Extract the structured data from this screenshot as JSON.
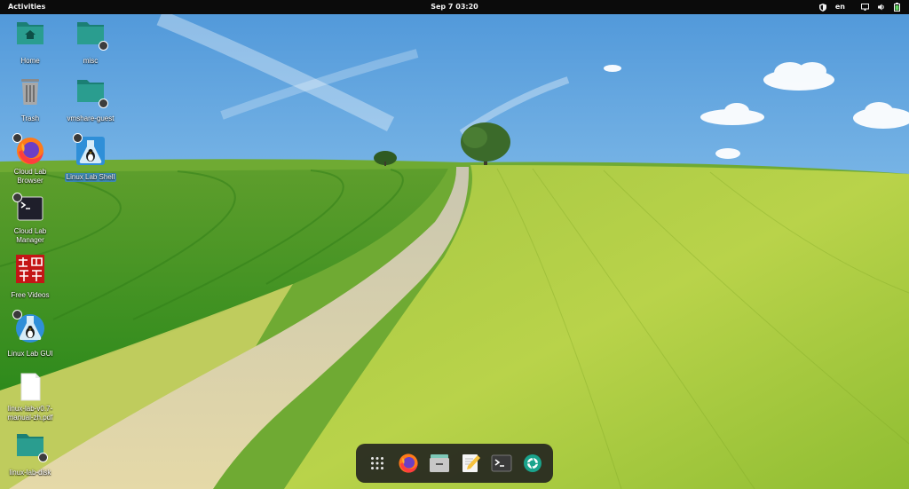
{
  "topbar": {
    "activities": "Activities",
    "clock": "Sep 7  03:20",
    "language": "en"
  },
  "desktop": {
    "icons": [
      {
        "label": "Home",
        "icon": "folder-home-icon"
      },
      {
        "label": "misc",
        "icon": "folder-link-icon"
      },
      {
        "label": "Trash",
        "icon": "trash-icon"
      },
      {
        "label": "vmshare-guest",
        "icon": "folder-link-icon"
      },
      {
        "label": "Cloud Lab Browser",
        "icon": "firefox-icon"
      },
      {
        "label": "Linux Lab Shell",
        "icon": "linux-lab-icon"
      },
      {
        "label": "Cloud Lab Manager",
        "icon": "terminal-icon"
      },
      {
        "label": "Free Videos",
        "icon": "free-videos-icon"
      },
      {
        "label": "Linux Lab GUI",
        "icon": "linux-lab-icon"
      },
      {
        "label": "linux-lab-v0.7-manual-zh.pdf",
        "icon": "pdf-document-icon"
      },
      {
        "label": "linux-lab-disk",
        "icon": "folder-link-icon"
      }
    ]
  },
  "dock": {
    "items": [
      "show-apps-icon",
      "firefox-icon",
      "files-icon",
      "text-editor-icon",
      "terminal-icon",
      "camera-aperture-icon"
    ]
  },
  "colors": {
    "folder": "#2a9d8f",
    "topbar": "#0b0b0b",
    "selection": "#3584e4"
  }
}
